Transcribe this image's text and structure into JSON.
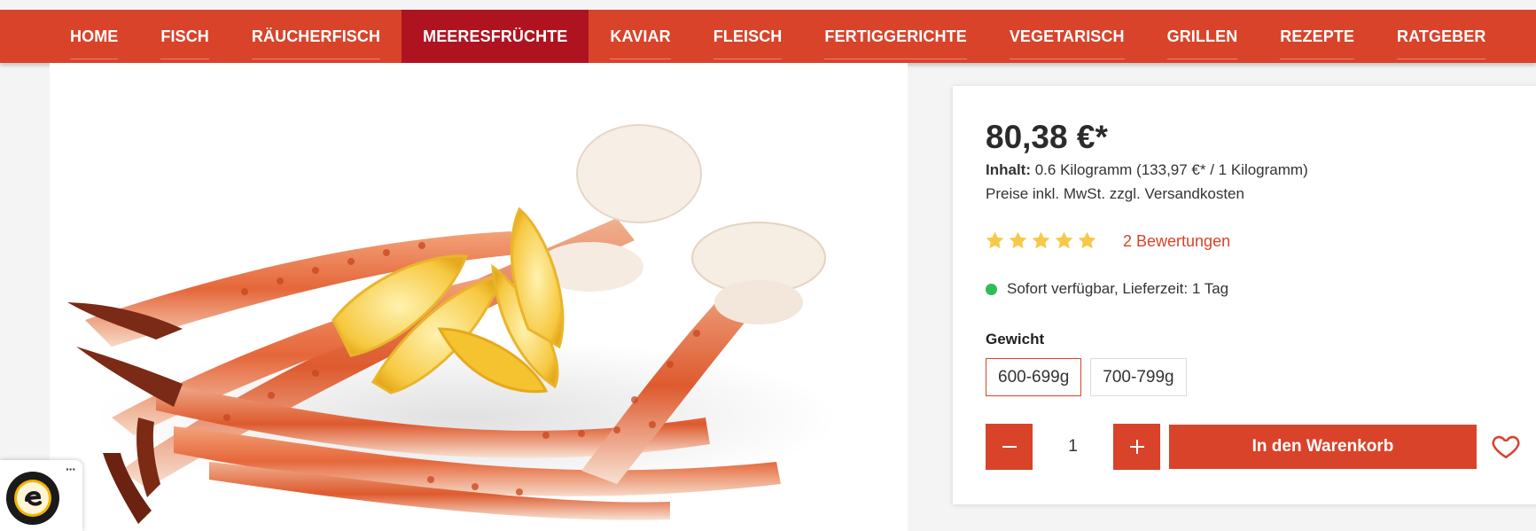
{
  "nav": {
    "items": [
      {
        "label": "HOME",
        "active": false
      },
      {
        "label": "FISCH",
        "active": false
      },
      {
        "label": "RÄUCHERFISCH",
        "active": false
      },
      {
        "label": "MEERESFRÜCHTE",
        "active": true
      },
      {
        "label": "KAVIAR",
        "active": false
      },
      {
        "label": "FLEISCH",
        "active": false
      },
      {
        "label": "FERTIGGERICHTE",
        "active": false
      },
      {
        "label": "VEGETARISCH",
        "active": false
      },
      {
        "label": "GRILLEN",
        "active": false
      },
      {
        "label": "REZEPTE",
        "active": false
      },
      {
        "label": "RATGEBER",
        "active": false
      }
    ]
  },
  "product": {
    "price": "80,38 €*",
    "content_label": "Inhalt:",
    "content_value": " 0.6 Kilogramm (133,97 €* / 1 Kilogramm)",
    "vat_note": "Preise inkl. MwSt. zzgl. Versandkosten",
    "rating": 5,
    "reviews_link": "2 Bewertungen",
    "availability": "Sofort verfügbar, Lieferzeit: 1 Tag",
    "weight_label": "Gewicht",
    "weight_options": [
      {
        "label": "600-699g",
        "selected": true
      },
      {
        "label": "700-799g",
        "selected": false
      }
    ],
    "quantity": "1",
    "add_to_cart": "In den Warenkorb"
  },
  "badge": {
    "menu_dots": "···"
  },
  "colors": {
    "brand": "#d9432a",
    "active_nav": "#b01320",
    "available": "#2ebd59",
    "star": "#f7c948"
  },
  "icons": {
    "minus": "minus-icon",
    "plus": "plus-icon",
    "wishlist": "heart-icon",
    "star": "star-icon",
    "seal": "trusted-shops-seal-icon"
  }
}
